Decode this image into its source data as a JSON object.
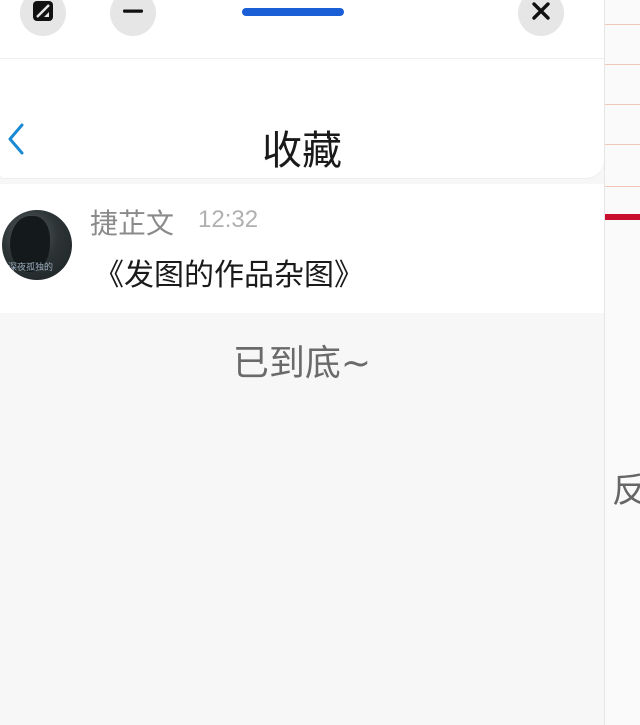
{
  "window": {
    "buttons": [
      {
        "name": "fullscreen",
        "icon": "expand-icon"
      },
      {
        "name": "minimize",
        "icon": "minus-icon"
      },
      {
        "name": "close",
        "icon": "close-icon"
      }
    ]
  },
  "header": {
    "title": "收藏",
    "back_icon": "chevron-left-icon"
  },
  "favorites": [
    {
      "sender": "捷芷文",
      "time": "12:32",
      "message": "《发图的作品杂图》",
      "avatar_caption": "深夜孤独的"
    }
  ],
  "footer": {
    "end_text": "已到底~"
  },
  "background": {
    "char": "反"
  },
  "colors": {
    "accent": "#1a5fd6",
    "back_arrow": "#1a8ad4",
    "red_stripe": "#c8102e"
  }
}
